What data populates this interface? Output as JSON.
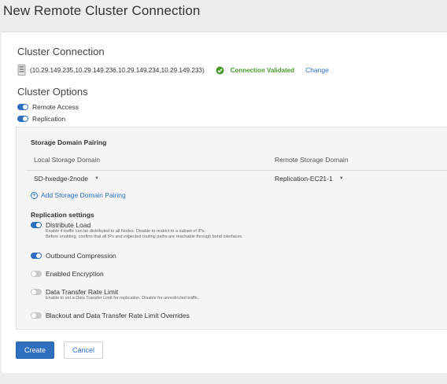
{
  "page": {
    "title": "New Remote Cluster Connection"
  },
  "cluster_connection": {
    "heading": "Cluster Connection",
    "icon": "server-icon",
    "ips": "(10.29.149.235,10.29.149.236,10.29.149.234,10.29.149.233)",
    "status": "Connection Validated",
    "status_icon": "check-circle-icon",
    "status_color": "#4a9a2d",
    "change_label": "Change"
  },
  "cluster_options": {
    "heading": "Cluster Options",
    "toggles": [
      {
        "label": "Remote Access",
        "on": true
      },
      {
        "label": "Replication",
        "on": true
      }
    ]
  },
  "pairing": {
    "heading": "Storage Domain Pairing",
    "col_local": "Local Storage Domain",
    "col_remote": "Remote Storage Domain",
    "local_value": "SD-hxedge-2node",
    "remote_value": "Replication-EC21-1",
    "add_label": "Add Storage Domain Pairing"
  },
  "replication_settings": {
    "heading": "Replication settings",
    "items": [
      {
        "label": "Distribute Load",
        "on": true,
        "desc1": "Enable if traffic can be distributed to all Nodes. Disable to restrict to a subset of IPs.",
        "desc2": "Before enabling, confirm that all IPs and expected routing paths are reachable through bond interfaces."
      },
      {
        "label": "Outbound Compression",
        "on": true
      },
      {
        "label": "Enabled Encryption",
        "on": false
      },
      {
        "label": "Data Transfer Rate Limit",
        "on": false,
        "desc1": "Enable to set a Data Transfer Limit for replication. Disable for unrestricted traffic."
      },
      {
        "label": "Blackout and Data Transfer Rate Limit Overrides",
        "on": false
      }
    ]
  },
  "actions": {
    "create": "Create",
    "cancel": "Cancel"
  },
  "colors": {
    "accent": "#2f6fc0",
    "link": "#2b70c4",
    "toggle_off": "#c8c8c8"
  }
}
